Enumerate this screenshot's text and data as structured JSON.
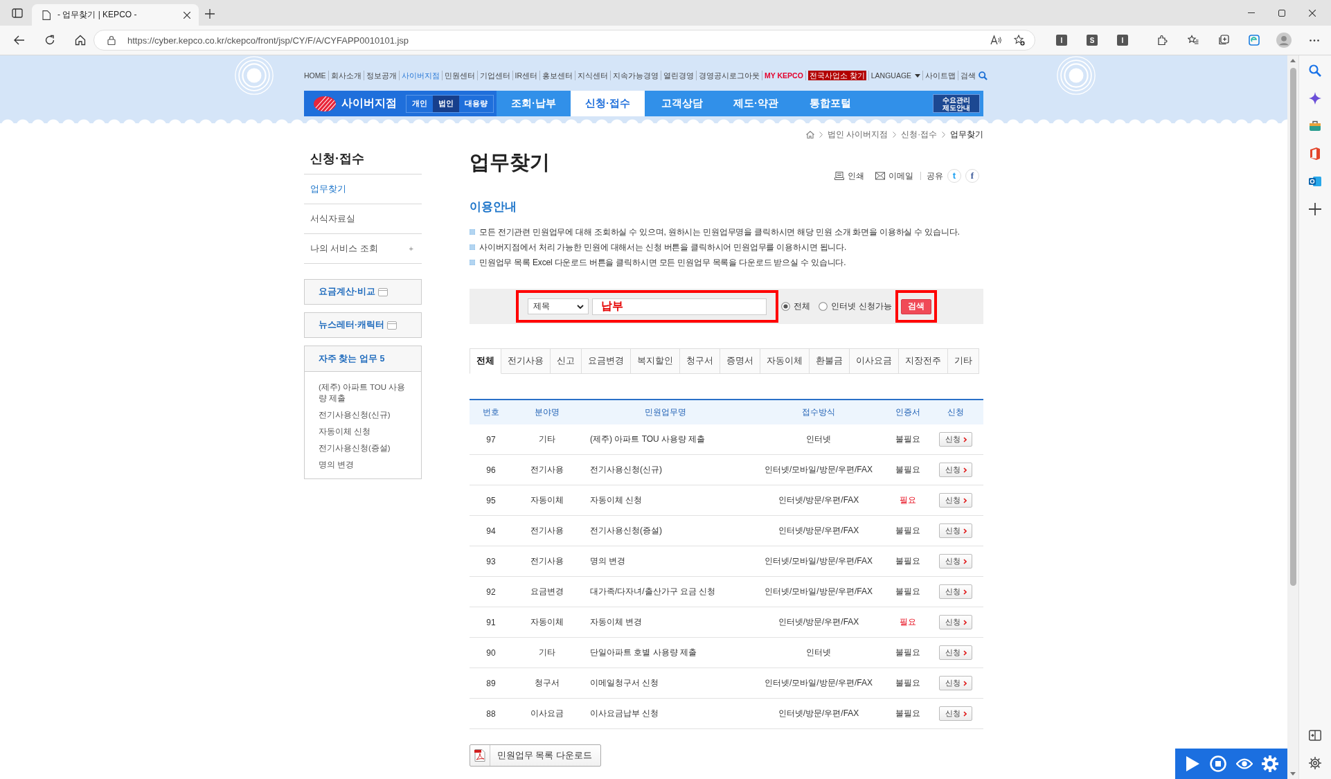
{
  "browser": {
    "tab_title": "- 업무찾기 | KEPCO -",
    "url": "https://cyber.kepco.co.kr/ckepco/front/jsp/CY/F/A/CYFAPP0010101.jsp",
    "extensions": [
      "I",
      "S",
      "I"
    ]
  },
  "header": {
    "utility_links": [
      {
        "label": "HOME",
        "selected": false
      },
      {
        "label": "회사소개",
        "selected": false
      },
      {
        "label": "정보공개",
        "selected": false
      },
      {
        "label": "사이버지점",
        "selected": true
      },
      {
        "label": "민원센터",
        "selected": false
      },
      {
        "label": "기업센터",
        "selected": false
      },
      {
        "label": "IR센터",
        "selected": false
      },
      {
        "label": "홍보센터",
        "selected": false
      },
      {
        "label": "지식센터",
        "selected": false
      },
      {
        "label": "지속가능경영",
        "selected": false
      },
      {
        "label": "열린경영",
        "selected": false
      },
      {
        "label": "경영공시",
        "selected": false
      }
    ],
    "account_links": [
      {
        "label": "로그아웃",
        "kind": "link"
      },
      {
        "label": "MY KEPCO",
        "kind": "accent"
      },
      {
        "label": "전국사업소 찾기",
        "kind": "badge"
      },
      {
        "label": "LANGUAGE",
        "kind": "dropdown"
      },
      {
        "label": "사이트맵",
        "kind": "link"
      },
      {
        "label": "검색",
        "kind": "search"
      }
    ],
    "brand": "사이버지점",
    "customer_types": [
      {
        "label": "개인",
        "selected": false
      },
      {
        "label": "법인",
        "selected": true
      },
      {
        "label": "대용량",
        "selected": false
      }
    ],
    "menu": [
      {
        "label": "조회·납부",
        "selected": false
      },
      {
        "label": "신청·접수",
        "selected": true
      },
      {
        "label": "고객상담",
        "selected": false
      },
      {
        "label": "제도·약관",
        "selected": false
      },
      {
        "label": "통합포털",
        "selected": false
      }
    ],
    "side_button": "수요관리 제도안내"
  },
  "breadcrumb": [
    "법인 사이버지점",
    "신청·접수",
    "업무찾기"
  ],
  "sidebar": {
    "title": "신청·접수",
    "items": [
      {
        "label": "업무찾기",
        "selected": true
      },
      {
        "label": "서식자료실",
        "selected": false
      },
      {
        "label": "나의 서비스 조회",
        "selected": false,
        "expander": "+"
      }
    ],
    "link_boxes": [
      "요금계산·비교",
      "뉴스레터·캐릭터"
    ],
    "favorites": {
      "title": "자주 찾는 업무 5",
      "items": [
        "(제주) 아파트 TOU 사용량 제출",
        "전기사용신청(신규)",
        "자동이체 신청",
        "전기사용신청(증설)",
        "명의 변경"
      ]
    }
  },
  "main": {
    "title": "업무찾기",
    "actions": [
      {
        "label": "인쇄",
        "kind": "print"
      },
      {
        "label": "이메일",
        "kind": "email"
      }
    ],
    "share": {
      "label": "공유",
      "networks": [
        {
          "kind": "twitter",
          "glyph": "t"
        },
        {
          "kind": "facebook",
          "glyph": "f"
        }
      ]
    },
    "guide": {
      "title": "이용안내",
      "items": [
        "모든 전기관련 민원업무에 대해 조회하실 수 있으며, 원하시는 민원업무명을 클릭하시면 해당 민원 소개 화면을 이용하실 수 있습니다.",
        "사이버지점에서 처리 가능한 민원에 대해서는 신청 버튼을 클릭하시어 민원업무를 이용하시면 됩니다.",
        "민원업무 목록 Excel 다운로드 버튼을 클릭하시면 모든 민원업무 목록을 다운로드 받으실 수 있습니다."
      ]
    }
  },
  "search": {
    "field": "제목",
    "query": "납부",
    "highlighted": true,
    "scopes": [
      {
        "label": "전체",
        "selected": true
      },
      {
        "label": "인터넷 신청가능",
        "selected": false
      }
    ],
    "button": {
      "label": "검색",
      "highlighted": true
    }
  },
  "tabs": [
    {
      "label": "전체",
      "selected": true
    },
    {
      "label": "전기사용",
      "selected": false
    },
    {
      "label": "신고",
      "selected": false
    },
    {
      "label": "요금변경",
      "selected": false
    },
    {
      "label": "복지할인",
      "selected": false
    },
    {
      "label": "청구서",
      "selected": false
    },
    {
      "label": "증명서",
      "selected": false
    },
    {
      "label": "자동이체",
      "selected": false
    },
    {
      "label": "환불금",
      "selected": false
    },
    {
      "label": "이사요금",
      "selected": false
    },
    {
      "label": "지장전주",
      "selected": false
    },
    {
      "label": "기타",
      "selected": false
    }
  ],
  "table": {
    "columns": [
      "번호",
      "분야명",
      "민원업무명",
      "접수방식",
      "인증서",
      "신청"
    ],
    "rows": [
      {
        "no": "97",
        "field": "기타",
        "name": "(제주) 아파트 TOU 사용량 제출",
        "method": "인터넷",
        "cert": "불필요",
        "cert_required": false,
        "apply": "신청"
      },
      {
        "no": "96",
        "field": "전기사용",
        "name": "전기사용신청(신규)",
        "method": "인터넷/모바일/방문/우편/FAX",
        "cert": "불필요",
        "cert_required": false,
        "apply": "신청"
      },
      {
        "no": "95",
        "field": "자동이체",
        "name": "자동이체 신청",
        "method": "인터넷/방문/우편/FAX",
        "cert": "필요",
        "cert_required": true,
        "apply": "신청"
      },
      {
        "no": "94",
        "field": "전기사용",
        "name": "전기사용신청(증설)",
        "method": "인터넷/방문/우편/FAX",
        "cert": "불필요",
        "cert_required": false,
        "apply": "신청"
      },
      {
        "no": "93",
        "field": "전기사용",
        "name": "명의 변경",
        "method": "인터넷/모바일/방문/우편/FAX",
        "cert": "불필요",
        "cert_required": false,
        "apply": "신청"
      },
      {
        "no": "92",
        "field": "요금변경",
        "name": "대가족/다자녀/출산가구 요금 신청",
        "method": "인터넷/모바일/방문/우편/FAX",
        "cert": "불필요",
        "cert_required": false,
        "apply": "신청"
      },
      {
        "no": "91",
        "field": "자동이체",
        "name": "자동이체 변경",
        "method": "인터넷/방문/우편/FAX",
        "cert": "필요",
        "cert_required": true,
        "apply": "신청"
      },
      {
        "no": "90",
        "field": "기타",
        "name": "단일아파트 호별 사용량 제출",
        "method": "인터넷",
        "cert": "불필요",
        "cert_required": false,
        "apply": "신청"
      },
      {
        "no": "89",
        "field": "청구서",
        "name": "이메일청구서 신청",
        "method": "인터넷/모바일/방문/우편/FAX",
        "cert": "불필요",
        "cert_required": false,
        "apply": "신청"
      },
      {
        "no": "88",
        "field": "이사요금",
        "name": "이사요금납부 신청",
        "method": "인터넷/방문/우편/FAX",
        "cert": "불필요",
        "cert_required": false,
        "apply": "신청"
      }
    ]
  },
  "download": "민원업무 목록 다운로드"
}
